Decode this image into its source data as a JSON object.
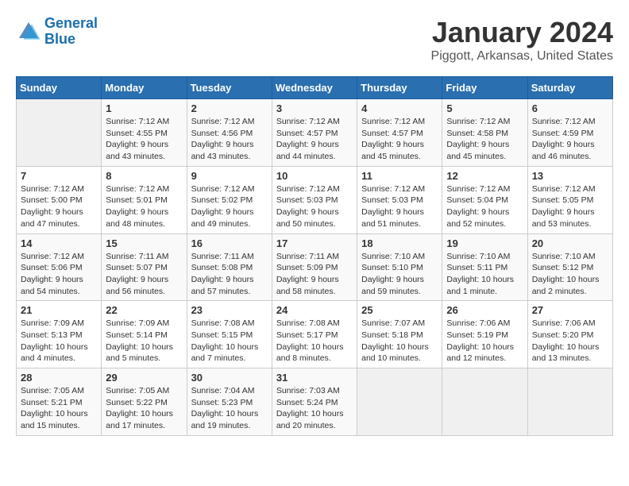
{
  "header": {
    "logo_line1": "General",
    "logo_line2": "Blue",
    "title": "January 2024",
    "subtitle": "Piggott, Arkansas, United States"
  },
  "calendar": {
    "days_of_week": [
      "Sunday",
      "Monday",
      "Tuesday",
      "Wednesday",
      "Thursday",
      "Friday",
      "Saturday"
    ],
    "weeks": [
      [
        {
          "day": "",
          "info": ""
        },
        {
          "day": "1",
          "info": "Sunrise: 7:12 AM\nSunset: 4:55 PM\nDaylight: 9 hours\nand 43 minutes."
        },
        {
          "day": "2",
          "info": "Sunrise: 7:12 AM\nSunset: 4:56 PM\nDaylight: 9 hours\nand 43 minutes."
        },
        {
          "day": "3",
          "info": "Sunrise: 7:12 AM\nSunset: 4:57 PM\nDaylight: 9 hours\nand 44 minutes."
        },
        {
          "day": "4",
          "info": "Sunrise: 7:12 AM\nSunset: 4:57 PM\nDaylight: 9 hours\nand 45 minutes."
        },
        {
          "day": "5",
          "info": "Sunrise: 7:12 AM\nSunset: 4:58 PM\nDaylight: 9 hours\nand 45 minutes."
        },
        {
          "day": "6",
          "info": "Sunrise: 7:12 AM\nSunset: 4:59 PM\nDaylight: 9 hours\nand 46 minutes."
        }
      ],
      [
        {
          "day": "7",
          "info": "Sunrise: 7:12 AM\nSunset: 5:00 PM\nDaylight: 9 hours\nand 47 minutes."
        },
        {
          "day": "8",
          "info": "Sunrise: 7:12 AM\nSunset: 5:01 PM\nDaylight: 9 hours\nand 48 minutes."
        },
        {
          "day": "9",
          "info": "Sunrise: 7:12 AM\nSunset: 5:02 PM\nDaylight: 9 hours\nand 49 minutes."
        },
        {
          "day": "10",
          "info": "Sunrise: 7:12 AM\nSunset: 5:03 PM\nDaylight: 9 hours\nand 50 minutes."
        },
        {
          "day": "11",
          "info": "Sunrise: 7:12 AM\nSunset: 5:03 PM\nDaylight: 9 hours\nand 51 minutes."
        },
        {
          "day": "12",
          "info": "Sunrise: 7:12 AM\nSunset: 5:04 PM\nDaylight: 9 hours\nand 52 minutes."
        },
        {
          "day": "13",
          "info": "Sunrise: 7:12 AM\nSunset: 5:05 PM\nDaylight: 9 hours\nand 53 minutes."
        }
      ],
      [
        {
          "day": "14",
          "info": "Sunrise: 7:12 AM\nSunset: 5:06 PM\nDaylight: 9 hours\nand 54 minutes."
        },
        {
          "day": "15",
          "info": "Sunrise: 7:11 AM\nSunset: 5:07 PM\nDaylight: 9 hours\nand 56 minutes."
        },
        {
          "day": "16",
          "info": "Sunrise: 7:11 AM\nSunset: 5:08 PM\nDaylight: 9 hours\nand 57 minutes."
        },
        {
          "day": "17",
          "info": "Sunrise: 7:11 AM\nSunset: 5:09 PM\nDaylight: 9 hours\nand 58 minutes."
        },
        {
          "day": "18",
          "info": "Sunrise: 7:10 AM\nSunset: 5:10 PM\nDaylight: 9 hours\nand 59 minutes."
        },
        {
          "day": "19",
          "info": "Sunrise: 7:10 AM\nSunset: 5:11 PM\nDaylight: 10 hours\nand 1 minute."
        },
        {
          "day": "20",
          "info": "Sunrise: 7:10 AM\nSunset: 5:12 PM\nDaylight: 10 hours\nand 2 minutes."
        }
      ],
      [
        {
          "day": "21",
          "info": "Sunrise: 7:09 AM\nSunset: 5:13 PM\nDaylight: 10 hours\nand 4 minutes."
        },
        {
          "day": "22",
          "info": "Sunrise: 7:09 AM\nSunset: 5:14 PM\nDaylight: 10 hours\nand 5 minutes."
        },
        {
          "day": "23",
          "info": "Sunrise: 7:08 AM\nSunset: 5:15 PM\nDaylight: 10 hours\nand 7 minutes."
        },
        {
          "day": "24",
          "info": "Sunrise: 7:08 AM\nSunset: 5:17 PM\nDaylight: 10 hours\nand 8 minutes."
        },
        {
          "day": "25",
          "info": "Sunrise: 7:07 AM\nSunset: 5:18 PM\nDaylight: 10 hours\nand 10 minutes."
        },
        {
          "day": "26",
          "info": "Sunrise: 7:06 AM\nSunset: 5:19 PM\nDaylight: 10 hours\nand 12 minutes."
        },
        {
          "day": "27",
          "info": "Sunrise: 7:06 AM\nSunset: 5:20 PM\nDaylight: 10 hours\nand 13 minutes."
        }
      ],
      [
        {
          "day": "28",
          "info": "Sunrise: 7:05 AM\nSunset: 5:21 PM\nDaylight: 10 hours\nand 15 minutes."
        },
        {
          "day": "29",
          "info": "Sunrise: 7:05 AM\nSunset: 5:22 PM\nDaylight: 10 hours\nand 17 minutes."
        },
        {
          "day": "30",
          "info": "Sunrise: 7:04 AM\nSunset: 5:23 PM\nDaylight: 10 hours\nand 19 minutes."
        },
        {
          "day": "31",
          "info": "Sunrise: 7:03 AM\nSunset: 5:24 PM\nDaylight: 10 hours\nand 20 minutes."
        },
        {
          "day": "",
          "info": ""
        },
        {
          "day": "",
          "info": ""
        },
        {
          "day": "",
          "info": ""
        }
      ]
    ]
  }
}
